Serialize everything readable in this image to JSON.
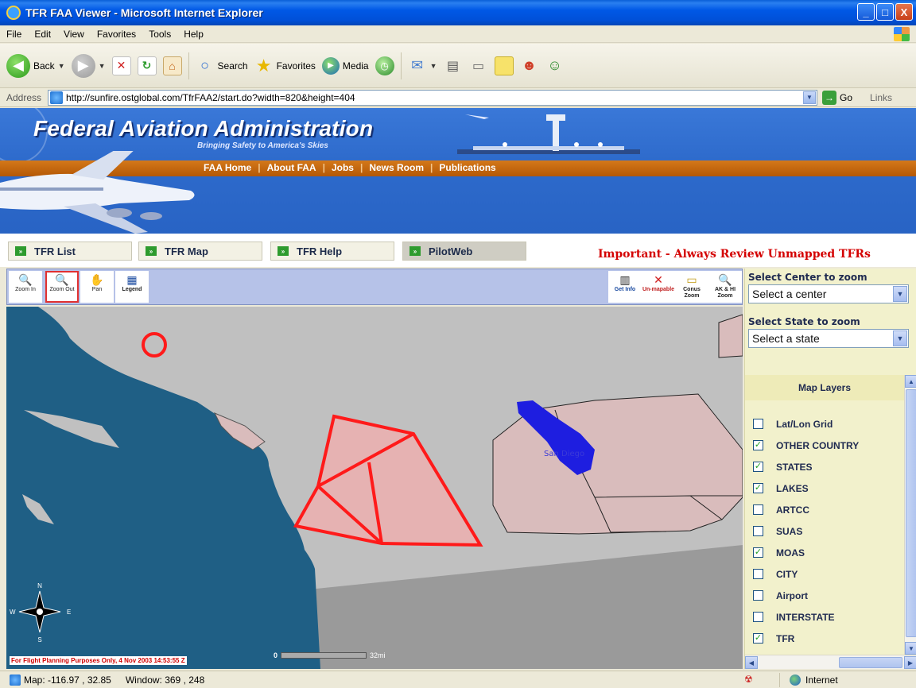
{
  "window": {
    "title": "TFR FAA Viewer - Microsoft Internet Explorer",
    "min_label": "_",
    "max_label": "□",
    "close_label": "X"
  },
  "menu": {
    "items": [
      "File",
      "Edit",
      "View",
      "Favorites",
      "Tools",
      "Help"
    ]
  },
  "toolbar": {
    "back_label": "Back",
    "search_label": "Search",
    "favorites_label": "Favorites",
    "media_label": "Media",
    "dropdown_glyph": "▼"
  },
  "address": {
    "label": "Address",
    "url": "http://sunfire.ostglobal.com/TfrFAA2/start.do?width=820&height=404",
    "go_label": "Go",
    "links_label": "Links"
  },
  "banner": {
    "title": "Federal Aviation Administration",
    "subtitle": "Bringing Safety to America's Skies",
    "nav": [
      "FAA Home",
      "About FAA",
      "Jobs",
      "News Room",
      "Publications"
    ],
    "nav_separator": "|"
  },
  "tabs": {
    "items": [
      "TFR List",
      "TFR Map",
      "TFR Help",
      "PilotWeb"
    ],
    "arrow_glyph": "»",
    "active": "PilotWeb",
    "important_notice": "Important - Always Review Unmapped TFRs"
  },
  "map_tools": {
    "left": [
      {
        "label": "Zoom In",
        "icon": "zoom-in-icon",
        "glyph": "🔍"
      },
      {
        "label": "Zoom Out",
        "icon": "zoom-out-icon",
        "glyph": "🔍"
      },
      {
        "label": "Pan",
        "icon": "pan-hand-icon",
        "glyph": "✋"
      },
      {
        "label": "Legend",
        "icon": "legend-icon",
        "glyph": "▦"
      }
    ],
    "right": [
      {
        "label": "Get Info",
        "icon": "get-info-icon",
        "glyph": "▥"
      },
      {
        "label": "Un-mapable",
        "icon": "unmapable-icon",
        "glyph": "✕"
      },
      {
        "label": "Conus Zoom",
        "icon": "conus-zoom-icon",
        "glyph": "▭"
      },
      {
        "label": "AK & HI Zoom",
        "icon": "ak-hi-zoom-icon",
        "glyph": "🔍"
      }
    ],
    "selected": "Zoom Out"
  },
  "map": {
    "label_text": "San Diego",
    "disclaimer": "For Flight Planning Purposes Only, 4 Nov 2003 14:53:55 Z",
    "scale_start": "0",
    "scale_end": "32mi",
    "compass": {
      "n": "N",
      "s": "S",
      "e": "E",
      "w": "W"
    },
    "colors": {
      "water": "#1f5f85",
      "land": "#c0c0c0",
      "lower_land": "#9a9a9a",
      "airspace": "#d9bcbc",
      "tfr_outline": "#ff1a1a",
      "tfr_fill": "#e6b2b2",
      "lake": "#1e1ee0"
    }
  },
  "panel": {
    "center_title": "Select Center to zoom",
    "center_value": "Select a center",
    "state_title": "Select State to zoom",
    "state_value": "Select a state",
    "layers_title": "Map Layers",
    "check_glyph": "✓",
    "layers": [
      {
        "name": "Lat/Lon Grid",
        "checked": false
      },
      {
        "name": "OTHER COUNTRY",
        "checked": true
      },
      {
        "name": "STATES",
        "checked": true
      },
      {
        "name": "LAKES",
        "checked": true
      },
      {
        "name": "ARTCC",
        "checked": false
      },
      {
        "name": "SUAS",
        "checked": false
      },
      {
        "name": "MOAS",
        "checked": true
      },
      {
        "name": "CITY",
        "checked": false
      },
      {
        "name": "Airport",
        "checked": false
      },
      {
        "name": "INTERSTATE",
        "checked": false
      },
      {
        "name": "TFR",
        "checked": true
      }
    ],
    "scroll_up": "▲",
    "scroll_down": "▼",
    "scroll_left": "◀",
    "scroll_right": "▶"
  },
  "status": {
    "map_coords": "Map: -116.97 , 32.85",
    "window_coords": "Window: 369 , 248",
    "zone": "Internet"
  }
}
